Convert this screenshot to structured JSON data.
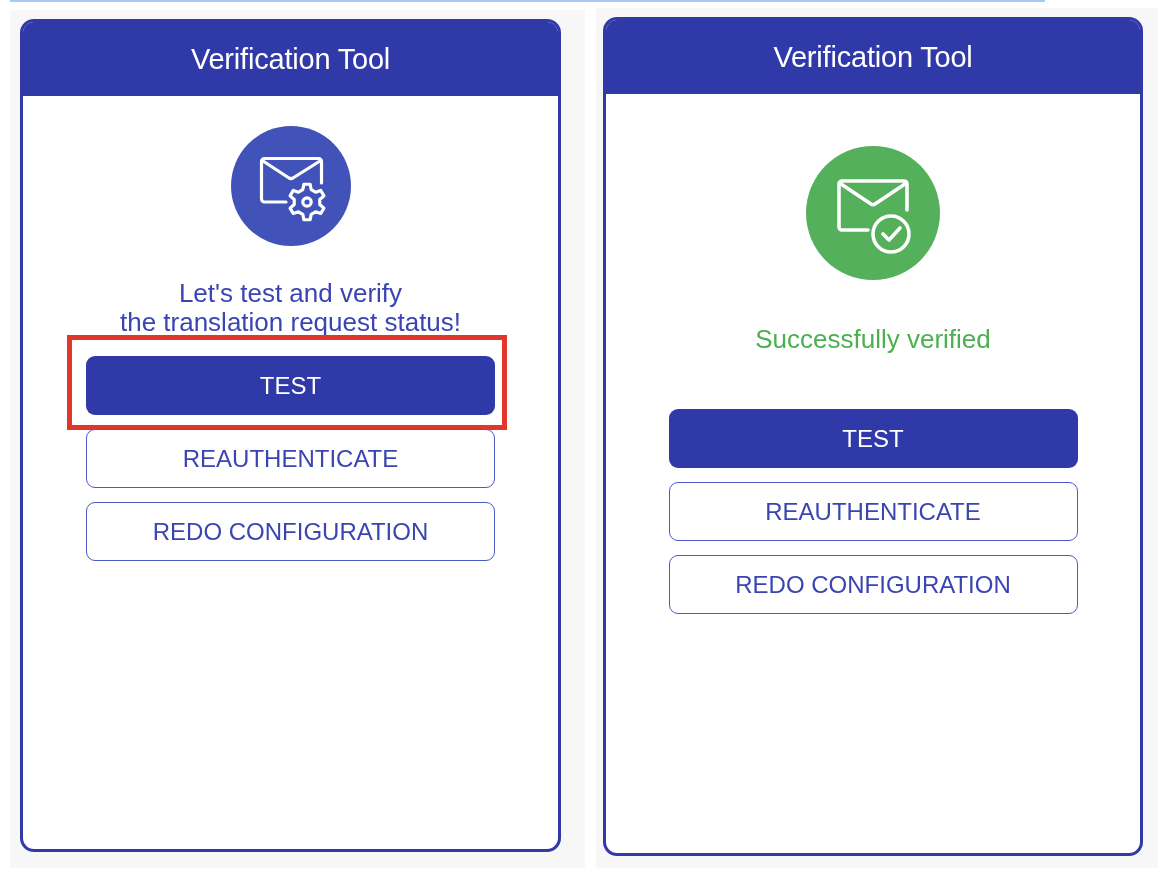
{
  "panels": [
    {
      "title": "Verification Tool",
      "icon": {
        "kind": "gear"
      },
      "message": {
        "kind": "prompt",
        "text": "Let's test and verify\nthe translation request status!"
      },
      "buttons": [
        {
          "label": "TEST",
          "kind": "primary",
          "highlighted": true
        },
        {
          "label": "REAUTHENTICATE",
          "kind": "outline",
          "highlighted": false
        },
        {
          "label": "REDO CONFIGURATION",
          "kind": "outline",
          "highlighted": false
        }
      ]
    },
    {
      "title": "Verification Tool",
      "icon": {
        "kind": "check"
      },
      "message": {
        "kind": "success",
        "text": "Successfully verified"
      },
      "buttons": [
        {
          "label": "TEST",
          "kind": "primary",
          "highlighted": false
        },
        {
          "label": "REAUTHENTICATE",
          "kind": "outline",
          "highlighted": false
        },
        {
          "label": "REDO CONFIGURATION",
          "kind": "outline",
          "highlighted": false
        }
      ]
    }
  ]
}
